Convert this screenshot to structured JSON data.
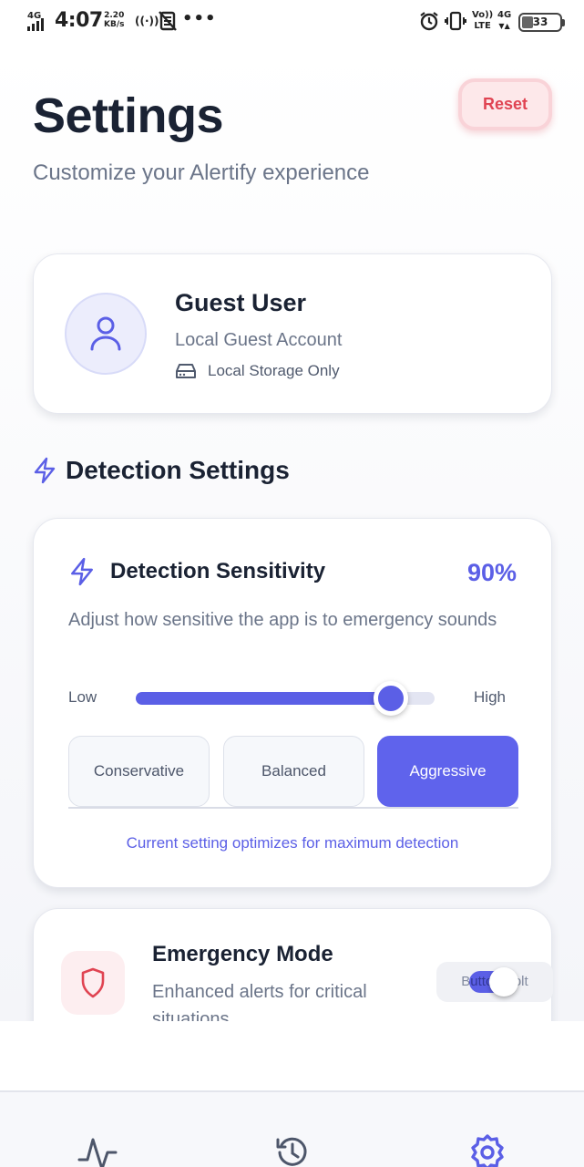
{
  "status_bar": {
    "network_tag": "4G",
    "time": "4:07",
    "speed_value": "2.20",
    "speed_unit": "KB/s",
    "volte_top": "Vo))",
    "volte_bottom": "LTE",
    "network_type": "4G",
    "battery": "33"
  },
  "header": {
    "title": "Settings",
    "subtitle": "Customize your Alertify experience",
    "reset_label": "Reset"
  },
  "user": {
    "name": "Guest User",
    "account_type": "Local Guest Account",
    "storage_label": "Local Storage Only"
  },
  "detection_section": {
    "title": "Detection Settings"
  },
  "sensitivity": {
    "title": "Detection Sensitivity",
    "value_label": "90%",
    "value": 0.9,
    "description": "Adjust how sensitive the app is to emergency sounds",
    "low_label": "Low",
    "high_label": "High",
    "modes": [
      "Conservative",
      "Balanced",
      "Aggressive"
    ],
    "active_mode": "Aggressive",
    "footer": "Current setting optimizes for maximum detection"
  },
  "emergency": {
    "title": "Emergency Mode",
    "description": "Enhanced alerts for critical situations",
    "toggle_overlay_text": "Button Bolt",
    "enabled": true
  },
  "colors": {
    "accent": "#5b5fe6",
    "danger": "#e04452"
  },
  "nav": {
    "items": [
      "activity-icon",
      "history-icon",
      "settings-gear-icon"
    ],
    "active": "settings-gear-icon"
  }
}
